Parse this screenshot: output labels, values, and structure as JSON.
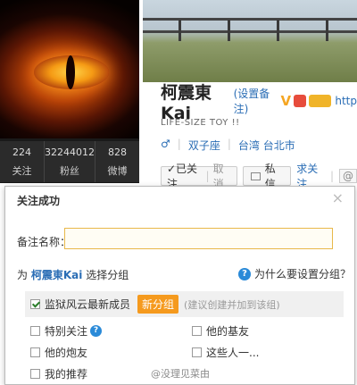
{
  "profile": {
    "stats": [
      {
        "num": "224",
        "label": "关注"
      },
      {
        "num": "32244012",
        "label": "粉丝"
      },
      {
        "num": "828",
        "label": "微博"
      }
    ],
    "name": "柯震東Kai",
    "remark": "(设置备注)",
    "verified_mark": "V",
    "link_partial": "http",
    "bio": "LIFE-SIZE TOY !!",
    "gender_icon": "male-icon",
    "constellation": "双子座",
    "location": "台湾 台北市",
    "followed_label": "✓已关注",
    "cancel_label": "取消",
    "message_label": "私信",
    "request_follow_label": "求关注",
    "at_label": "@"
  },
  "dialog": {
    "title": "关注成功",
    "close_label": "×",
    "remark_label": "备注名称：",
    "remark_value": "",
    "group_prompt_prefix": "为",
    "group_prompt_name": "柯震東Kai",
    "group_prompt_suffix": "选择分组",
    "help_label": "为什么要设置分组？",
    "first_group": "监狱风云最新成员",
    "new_group_button": "新分组",
    "new_group_hint": "(建议创建并加到该组)",
    "groups": [
      {
        "label": "特别关注",
        "checked": false
      },
      {
        "label": "他的基友",
        "checked": false
      },
      {
        "label": "他的炮友",
        "checked": false
      },
      {
        "label": "这些人一...",
        "checked": false
      },
      {
        "label": "我的推荐",
        "checked": false
      }
    ]
  },
  "watermark": "@没理见菜由",
  "colors": {
    "accent_blue": "#2a6db5",
    "new_group_orange": "#f59a1e",
    "input_border": "#e8b84a"
  }
}
